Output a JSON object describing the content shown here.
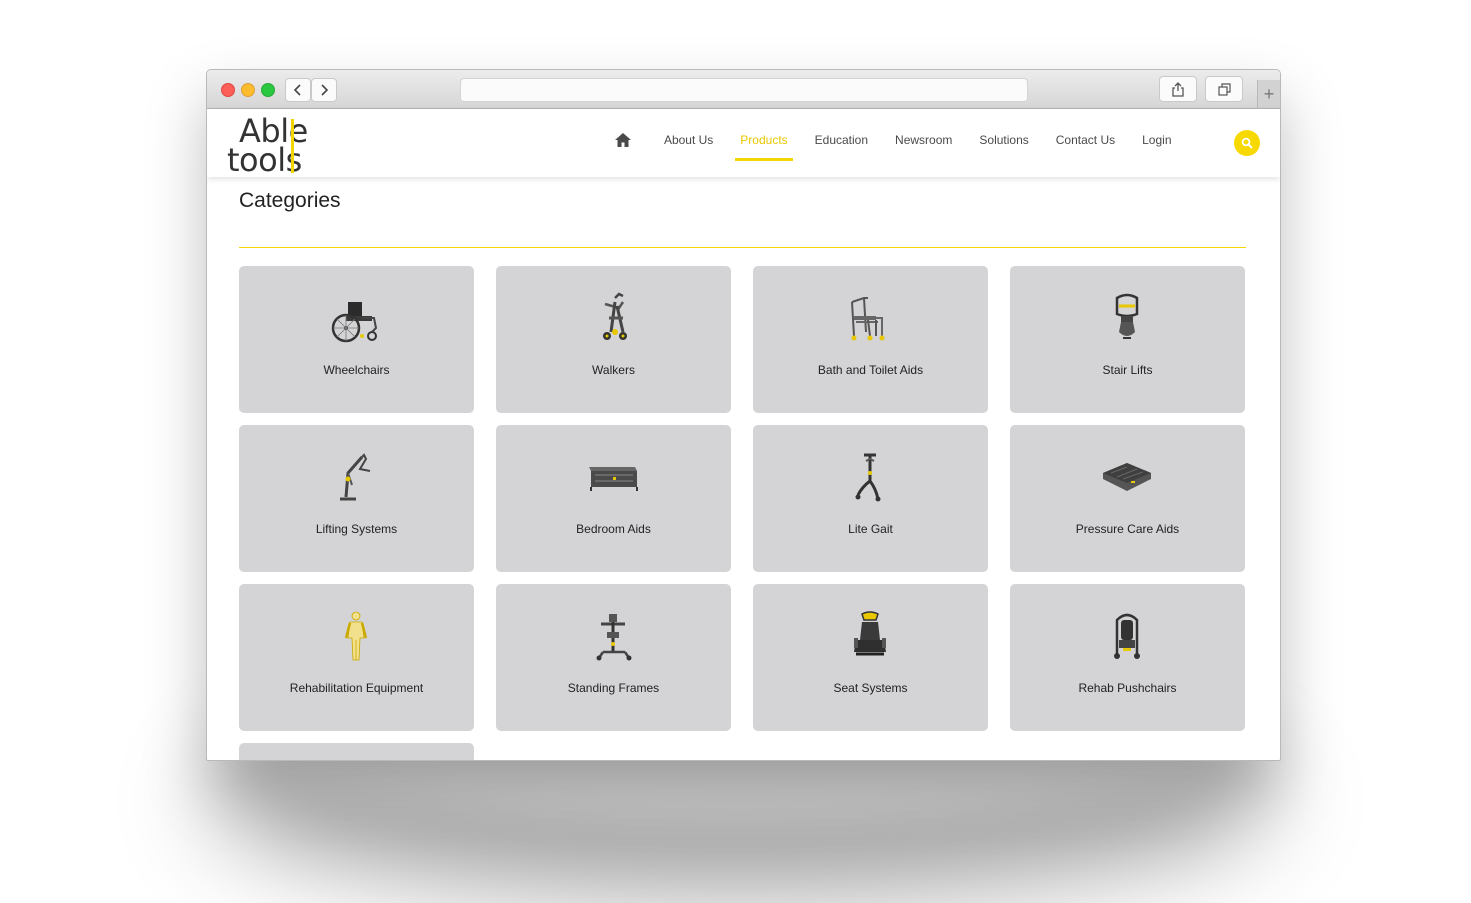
{
  "header": {
    "logo_line1": "Able",
    "logo_line2": "tools",
    "nav": [
      {
        "label": "About Us"
      },
      {
        "label": "Products"
      },
      {
        "label": "Education"
      },
      {
        "label": "Newsroom"
      },
      {
        "label": "Solutions"
      },
      {
        "label": "Contact Us"
      },
      {
        "label": "Login"
      }
    ],
    "active_nav": "Products",
    "accent_color": "#f2d600"
  },
  "page": {
    "title": "Categories"
  },
  "categories": [
    {
      "label": "Wheelchairs",
      "icon": "wheelchair-icon"
    },
    {
      "label": "Walkers",
      "icon": "walker-icon"
    },
    {
      "label": "Bath and Toilet Aids",
      "icon": "bath-chair-icon"
    },
    {
      "label": "Stair Lifts",
      "icon": "stair-lift-icon"
    },
    {
      "label": "Lifting Systems",
      "icon": "patient-lift-icon"
    },
    {
      "label": "Bedroom Aids",
      "icon": "bed-icon"
    },
    {
      "label": "Lite Gait",
      "icon": "gait-trainer-icon"
    },
    {
      "label": "Pressure Care Aids",
      "icon": "cushion-icon"
    },
    {
      "label": "Rehabilitation Equipment",
      "icon": "human-figure-icon"
    },
    {
      "label": "Standing Frames",
      "icon": "standing-frame-icon"
    },
    {
      "label": "Seat Systems",
      "icon": "seat-system-icon"
    },
    {
      "label": "Rehab Pushchairs",
      "icon": "pushchair-icon"
    }
  ]
}
